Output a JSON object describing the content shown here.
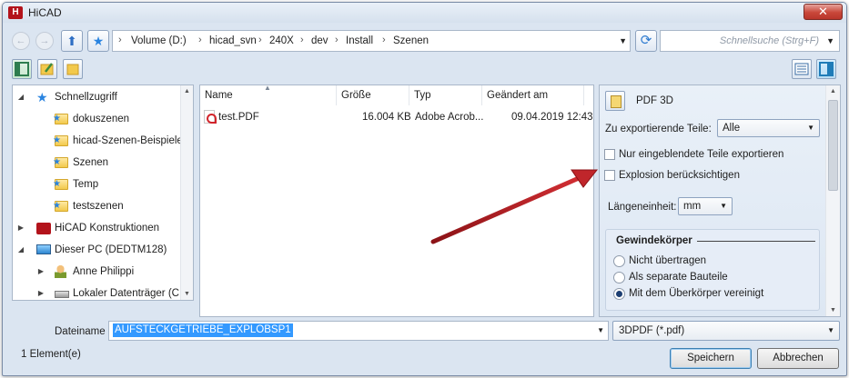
{
  "window": {
    "title": "HiCAD",
    "close_glyph": "✕"
  },
  "toolbar": {
    "back_glyph": "←",
    "forward_glyph": "→",
    "up_glyph": "⬆",
    "quick_glyph": "★",
    "breadcrumbs": [
      "Volume (D:)",
      "hicad_svn",
      "240X",
      "dev",
      "Install",
      "Szenen"
    ],
    "refresh_glyph": "⟳",
    "search_placeholder": "Schnellsuche (Strg+F)"
  },
  "tree": {
    "items": [
      {
        "label": "Schnellzugriff",
        "icon": "star-icon"
      },
      {
        "label": "dokuszenen",
        "icon": "folder-icon"
      },
      {
        "label": "hicad-Szenen-Beispiele",
        "icon": "folder-icon"
      },
      {
        "label": "Szenen",
        "icon": "folder-icon"
      },
      {
        "label": "Temp",
        "icon": "folder-icon"
      },
      {
        "label": "testszenen",
        "icon": "folder-icon"
      },
      {
        "label": "HiCAD Konstruktionen",
        "icon": "hicad-icon"
      },
      {
        "label": "Dieser PC (DEDTM128)",
        "icon": "computer-icon"
      },
      {
        "label": "Anne Philippi",
        "icon": "user-icon"
      },
      {
        "label": "Lokaler Datenträger (C:)",
        "icon": "drive-icon"
      }
    ]
  },
  "files": {
    "columns": [
      "Name",
      "Größe",
      "Typ",
      "Geändert am"
    ],
    "rows": [
      {
        "name": "test.PDF",
        "size": "16.004 KB",
        "type": "Adobe Acrob...",
        "modified": "09.04.2019 12:43"
      }
    ]
  },
  "panel": {
    "title": "PDF 3D",
    "parts_label": "Zu exportierende Teile:",
    "parts_value": "Alle",
    "checkbox_visible_only": "Nur eingeblendete Teile exportieren",
    "checkbox_explosion": "Explosion berücksichtigen",
    "unit_label": "Längeneinheit:",
    "unit_value": "mm",
    "group_title": "Gewindekörper",
    "radio_options": [
      "Nicht übertragen",
      "Als separate Bauteile",
      "Mit dem Überkörper vereinigt"
    ],
    "radio_selected_index": 2
  },
  "footer": {
    "filename_label": "Dateiname :",
    "filename_value": "AUFSTECKGETRIEBE_EXPLOBSP1",
    "filetype_value": "3DPDF (*.pdf)",
    "status": "1 Element(e)",
    "save_label": "Speichern",
    "cancel_label": "Abbrechen"
  },
  "colors": {
    "accent": "#3399ff",
    "arrow": "#c0262b",
    "window_bg": "#dbe5f1"
  }
}
